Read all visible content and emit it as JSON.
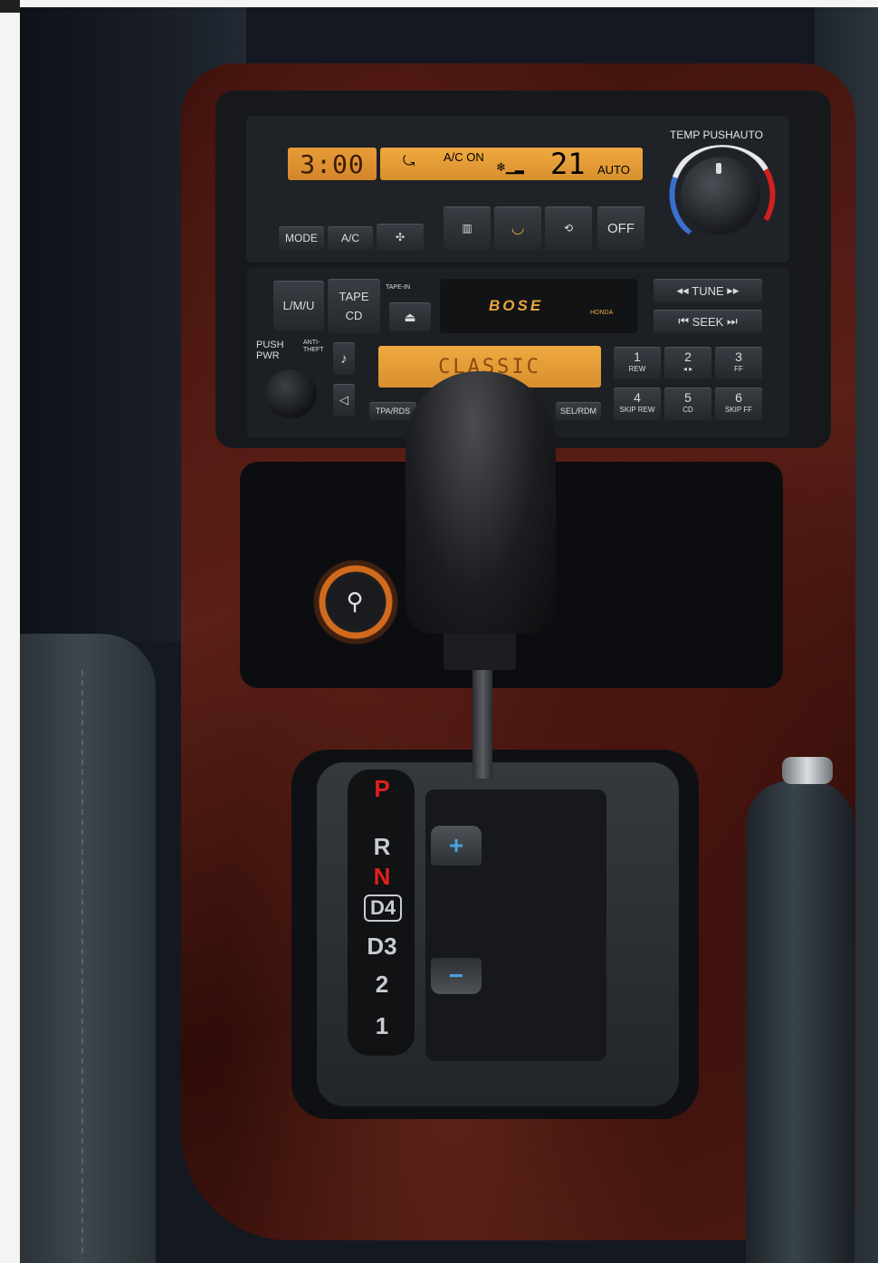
{
  "climate": {
    "clock": "3:00",
    "ac_status": "A/C ON",
    "fan_symbol": "❄▁▂",
    "temperature": "21",
    "auto_mode": "AUTO",
    "temp_knob_label": "TEMP PUSHAUTO",
    "mode_label": "MODE",
    "ac_label": "A/C",
    "off_label": "OFF"
  },
  "audio": {
    "lmu_label": "L/M/U",
    "tape_label": "TAPE",
    "cd_label": "CD",
    "tape_in_label": "TAPE-IN",
    "brand": "BOSE",
    "maker": "HONDA",
    "tune_label": "TUNE",
    "seek_label": "SEEK",
    "push_pwr_label": "PUSH PWR",
    "anti_theft_label": "ANTI-THEFT",
    "display_text": "CLASSIC",
    "tpa_label": "TPA/RDS",
    "sel_label": "SEL/RDM",
    "presets": [
      {
        "num": "1",
        "sub": "REW"
      },
      {
        "num": "2",
        "sub": "◂ ▸"
      },
      {
        "num": "3",
        "sub": "FF"
      },
      {
        "num": "4",
        "sub": "SKIP REW"
      },
      {
        "num": "5",
        "sub": "CD"
      },
      {
        "num": "6",
        "sub": "SKIP FF"
      }
    ]
  },
  "shifter": {
    "gears": [
      "P",
      "R",
      "N",
      "D4",
      "D3",
      "2",
      "1"
    ],
    "plus": "+",
    "minus": "−"
  },
  "colors": {
    "display_amber": "#e89c38",
    "wood": "#5b2017",
    "gear_red": "#e0201a",
    "sequential_blue": "#4aa0e0"
  }
}
